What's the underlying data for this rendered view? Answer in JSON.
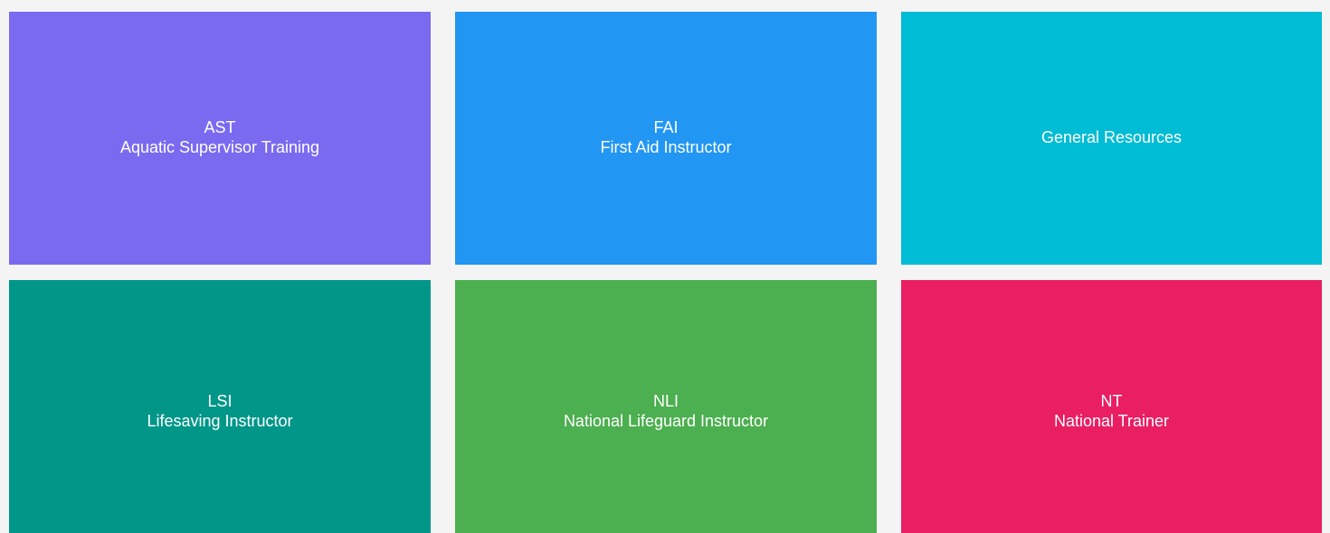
{
  "tiles": [
    {
      "code": "AST",
      "name": "Aquatic Supervisor Training",
      "color": "#7a6af0"
    },
    {
      "code": "FAI",
      "name": "First Aid Instructor",
      "color": "#2196f3"
    },
    {
      "code": "",
      "name": "General Resources",
      "color": "#00bcd4"
    },
    {
      "code": "LSI",
      "name": "Lifesaving Instructor",
      "color": "#009688"
    },
    {
      "code": "NLI",
      "name": "National Lifeguard Instructor",
      "color": "#4caf50"
    },
    {
      "code": "NT",
      "name": "National Trainer",
      "color": "#e91e63"
    }
  ]
}
